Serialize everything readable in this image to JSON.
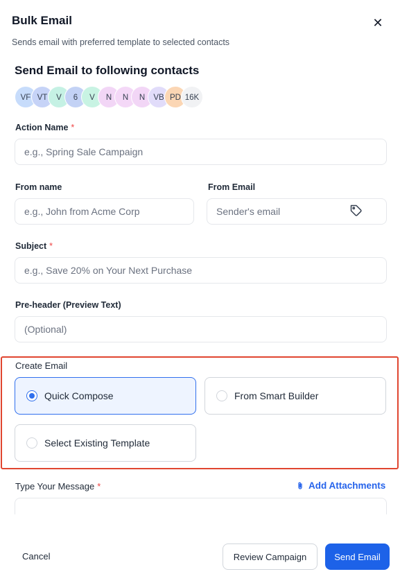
{
  "header": {
    "title": "Bulk Email",
    "subtitle": "Sends email with preferred template to selected contacts",
    "close_icon": "close-icon"
  },
  "contacts": {
    "heading": "Send Email to following contacts",
    "avatars": [
      {
        "initials": "VF",
        "color": "#c7dcfb"
      },
      {
        "initials": "VT",
        "color": "#c6d3f7"
      },
      {
        "initials": "V",
        "color": "#c5f1e4"
      },
      {
        "initials": "6",
        "color": "#c3d2f5"
      },
      {
        "initials": "V",
        "color": "#c8f3e3"
      },
      {
        "initials": "N",
        "color": "#f2d6f6"
      },
      {
        "initials": "N",
        "color": "#f4d8f7"
      },
      {
        "initials": "N",
        "color": "#f2d6f6"
      },
      {
        "initials": "VB",
        "color": "#e1dcfa"
      },
      {
        "initials": "PD",
        "color": "#fbd6b4"
      },
      {
        "initials": "16K",
        "color": "#f1f2f4"
      }
    ]
  },
  "form": {
    "action_name": {
      "label": "Action Name",
      "required_mark": "*",
      "placeholder": "e.g., Spring Sale Campaign",
      "value": ""
    },
    "from_name": {
      "label": "From name",
      "placeholder": "e.g., John from Acme Corp",
      "value": ""
    },
    "from_email": {
      "label": "From Email",
      "placeholder": "Sender's email",
      "value": "",
      "icon": "tag-icon"
    },
    "subject": {
      "label": "Subject",
      "required_mark": "*",
      "placeholder": "e.g., Save 20% on Your Next Purchase",
      "value": ""
    },
    "preheader": {
      "label": "Pre-header (Preview Text)",
      "placeholder": "(Optional)",
      "value": ""
    }
  },
  "create_email": {
    "label": "Create Email",
    "options": [
      {
        "label": "Quick Compose",
        "selected": true
      },
      {
        "label": "From Smart Builder",
        "selected": false
      },
      {
        "label": "Select Existing Template",
        "selected": false
      }
    ],
    "highlight_color": "#e0452f"
  },
  "message": {
    "label": "Type Your Message",
    "required_mark": "*",
    "attach_label": "Add Attachments",
    "attach_icon": "paperclip-icon"
  },
  "footer": {
    "cancel_label": "Cancel",
    "review_label": "Review Campaign",
    "send_label": "Send Email",
    "accent": "#1d62e8"
  }
}
